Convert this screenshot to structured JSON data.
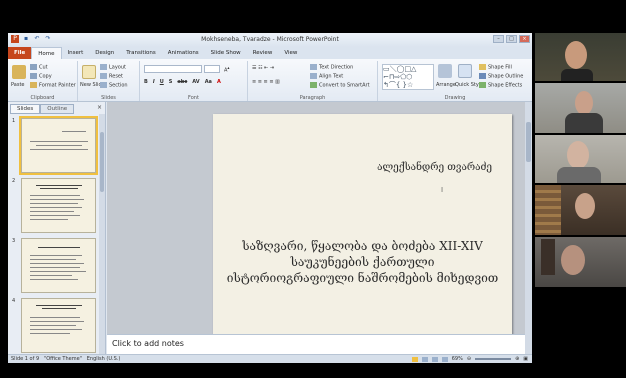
{
  "window": {
    "title": "Mokhseneba, Tvaradze - Microsoft PowerPoint"
  },
  "ribbon_tabs": [
    "File",
    "Home",
    "Insert",
    "Design",
    "Transitions",
    "Animations",
    "Slide Show",
    "Review",
    "View"
  ],
  "ribbon": {
    "clipboard": {
      "paste": "Paste",
      "cut": "Cut",
      "copy": "Copy",
      "format_painter": "Format Painter",
      "label": "Clipboard"
    },
    "slides": {
      "new_slide": "New Slide",
      "layout": "Layout",
      "reset": "Reset",
      "section": "Section",
      "label": "Slides"
    },
    "font": {
      "label": "Font",
      "buttons": [
        "B",
        "I",
        "U",
        "S",
        "abc",
        "AV",
        "Aa",
        "A"
      ]
    },
    "paragraph": {
      "text_direction": "Text Direction",
      "align_text": "Align Text",
      "convert_smartart": "Convert to SmartArt",
      "label": "Paragraph"
    },
    "drawing": {
      "arrange": "Arrange",
      "quick_styles": "Quick Styles",
      "shape_fill": "Shape Fill",
      "shape_outline": "Shape Outline",
      "shape_effects": "Shape Effects",
      "label": "Drawing"
    }
  },
  "panel": {
    "tabs": [
      "Slides",
      "Outline"
    ],
    "close": "×",
    "slide_numbers": [
      "1",
      "2",
      "3",
      "4"
    ]
  },
  "slide": {
    "author": "ალექსანდრე თვარაძე",
    "title_line1": "საზღვარი, წყალობა და ბოძება XII-XIV",
    "title_line2": "საუკუნეების ქართული",
    "title_line3": "ისტორიოგრაფიული ნაშრომების მიხედვით"
  },
  "notes": {
    "placeholder": "Click to add notes"
  },
  "status": {
    "slide_of": "Slide 1 of 9",
    "theme": "\"Office Theme\"",
    "language": "English (U.S.)",
    "zoom": "69%"
  },
  "colors": {
    "file_tab": "#c6461d",
    "slide_bg": "#f3f0e4",
    "thumb_selected": "#f0c040"
  }
}
